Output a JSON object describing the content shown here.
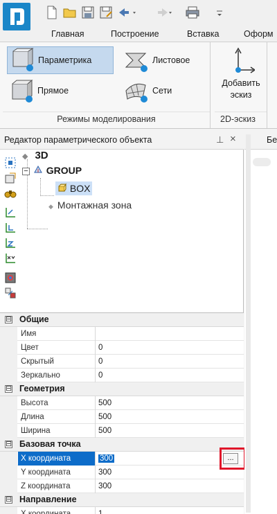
{
  "ribbon_tabs": [
    {
      "label": "Главная"
    },
    {
      "label": "Построение"
    },
    {
      "label": "Вставка"
    },
    {
      "label": "Оформ"
    }
  ],
  "ribbon": {
    "modeling_group": {
      "buttons": [
        {
          "label": "Параметрика",
          "selected": true
        },
        {
          "label": "Листовое"
        },
        {
          "label": "Прямое"
        },
        {
          "label": "Сети"
        }
      ],
      "caption": "Режимы моделирования"
    },
    "sketch_group": {
      "button_line1": "Добавить",
      "button_line2": "эскиз",
      "caption": "2D-эскиз"
    }
  },
  "panel": {
    "title": "Редактор параметрического объекта",
    "pin_glyph": "⊥",
    "close_glyph": "×"
  },
  "tree": {
    "root": "3D",
    "group": "GROUP",
    "box": "BOX",
    "zone": "Монтажная зона"
  },
  "properties": {
    "categories": [
      {
        "title": "Общие",
        "toggle": "⊟"
      },
      {
        "title": "Геометрия",
        "toggle": "⊟"
      },
      {
        "title": "Базовая точка",
        "toggle": "⊟"
      },
      {
        "title": "Направление",
        "toggle": "⊟"
      }
    ],
    "general": [
      {
        "name": "Имя",
        "value": ""
      },
      {
        "name": "Цвет",
        "value": "0"
      },
      {
        "name": "Скрытый",
        "value": "0"
      },
      {
        "name": "Зеркально",
        "value": "0"
      }
    ],
    "geometry": [
      {
        "name": "Высота",
        "value": "500"
      },
      {
        "name": "Длина",
        "value": "500"
      },
      {
        "name": "Ширина",
        "value": "500"
      }
    ],
    "base_point": [
      {
        "name": "X координата",
        "value": "300",
        "selected": true
      },
      {
        "name": "Y координата",
        "value": "300"
      },
      {
        "name": "Z координата",
        "value": "300"
      }
    ],
    "direction": [
      {
        "name": "X координата",
        "value": "1"
      }
    ],
    "browse_button_label": "..."
  },
  "document_tab": {
    "label": "Бе"
  },
  "colors": {
    "accent": "#0d6cc9",
    "logo": "#1a86c8",
    "highlight": "#e0162a"
  }
}
